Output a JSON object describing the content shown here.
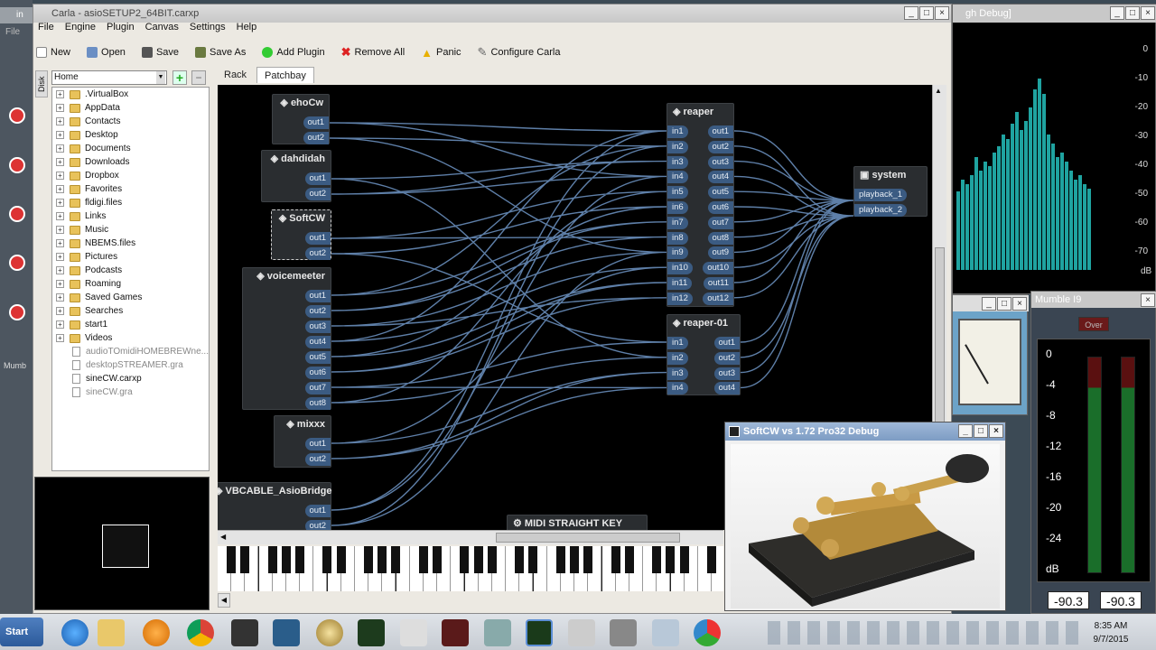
{
  "left_app": {
    "title_fragment": "in",
    "menu_file": "File",
    "panel_title": "Mumb"
  },
  "carla": {
    "title": "Carla - asioSETUP2_64BIT.carxp",
    "menu": [
      "File",
      "Engine",
      "Plugin",
      "Canvas",
      "Settings",
      "Help"
    ],
    "toolbar": {
      "new": "New",
      "open": "Open",
      "save": "Save",
      "save_as": "Save As",
      "add_plugin": "Add Plugin",
      "remove_all": "Remove All",
      "panic": "Panic",
      "configure": "Configure Carla"
    },
    "side_tab": "Disk",
    "path_value": "Home",
    "tabs": {
      "rack": "Rack",
      "patchbay": "Patchbay"
    },
    "tree_folders": [
      ".VirtualBox",
      "AppData",
      "Contacts",
      "Desktop",
      "Documents",
      "Downloads",
      "Dropbox",
      "Favorites",
      "fldigi.files",
      "Links",
      "Music",
      "NBEMS.files",
      "Pictures",
      "Podcasts",
      "Roaming",
      "Saved Games",
      "Searches",
      "start1",
      "Videos"
    ],
    "tree_files": [
      "audioTOmidiHOMEBREWne...",
      "desktopSTREAMER.gra",
      "sineCW.carxp",
      "sineCW.gra"
    ],
    "nodes": {
      "ehocw": {
        "name": "ehoCw",
        "ports": [
          "out1",
          "out2"
        ]
      },
      "dahdidah": {
        "name": "dahdidah",
        "ports": [
          "out1",
          "out2"
        ]
      },
      "softcw": {
        "name": "SoftCW",
        "ports": [
          "out1",
          "out2"
        ]
      },
      "voicemeeter": {
        "name": "voicemeeter",
        "ports": [
          "out1",
          "out2",
          "out3",
          "out4",
          "out5",
          "out6",
          "out7",
          "out8"
        ]
      },
      "mixxx": {
        "name": "mixxx",
        "ports": [
          "out1",
          "out2"
        ]
      },
      "vbcable": {
        "name": "VBCABLE_AsioBridge",
        "ports": [
          "out1",
          "out2"
        ]
      },
      "midikey": {
        "name": "MIDI STRAIGHT KEY"
      },
      "reaper": {
        "name": "reaper",
        "ins": [
          "in1",
          "in2",
          "in3",
          "in4",
          "in5",
          "in6",
          "in7",
          "in8",
          "in9",
          "in10",
          "in11",
          "in12"
        ],
        "outs": [
          "out1",
          "out2",
          "out3",
          "out4",
          "out5",
          "out6",
          "out7",
          "out8",
          "out9",
          "out10",
          "out11",
          "out12"
        ]
      },
      "reaper01": {
        "name": "reaper-01",
        "ins": [
          "in1",
          "in2",
          "in3",
          "in4"
        ],
        "outs": [
          "out1",
          "out2",
          "out3",
          "out4"
        ]
      },
      "system": {
        "name": "system",
        "ports": [
          "playback_1",
          "playback_2"
        ]
      }
    }
  },
  "spectrum": {
    "title_fragment": "gh Debug]",
    "scale": [
      "0",
      "-10",
      "-20",
      "-30",
      "-40",
      "-50",
      "-60",
      "-70"
    ],
    "unit": "dB"
  },
  "softcw": {
    "title": "SoftCW vs 1.72 Pro32 Debug"
  },
  "mumble": {
    "title": "Mumble I9",
    "over_label": "Over",
    "scale": [
      "0",
      "-4",
      "-8",
      "-12",
      "-16",
      "-20",
      "-24",
      "dB"
    ],
    "left_value": "-90.3",
    "right_value": "-90.3"
  },
  "taskbar": {
    "start": "Start",
    "time": "8:35 AM",
    "date": "9/7/2015"
  }
}
